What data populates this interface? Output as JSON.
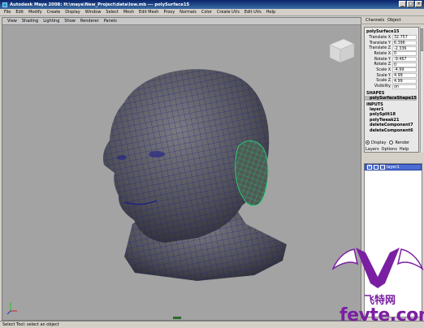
{
  "window": {
    "title": "Autodesk Maya 2008: H:\\maya\\New_Project\\data\\low.mb  ---  polySurface15",
    "minimize": "_",
    "maximize": "□",
    "close": "×"
  },
  "menubar": [
    "File",
    "Edit",
    "Modify",
    "Create",
    "Display",
    "Window",
    "Select",
    "Mesh",
    "Edit Mesh",
    "Proxy",
    "Normals",
    "Color",
    "Create UVs",
    "Edit UVs",
    "Help"
  ],
  "viewport": {
    "menu": [
      "View",
      "Shading",
      "Lighting",
      "Show",
      "Renderer",
      "Panels"
    ],
    "background": "#a3a3a3",
    "mesh_color": "#5a5a62",
    "wire_color": "#1a1a8a",
    "selection_color": "#22e07a"
  },
  "channel_box": {
    "tabs": [
      "Channels",
      "Object"
    ],
    "node": "polySurface15",
    "attributes": [
      {
        "name": "Translate X",
        "value": "32.757"
      },
      {
        "name": "Translate Y",
        "value": "6.396"
      },
      {
        "name": "Translate Z",
        "value": "-2.336"
      },
      {
        "name": "Rotate X",
        "value": "0"
      },
      {
        "name": "Rotate Y",
        "value": "-9.467"
      },
      {
        "name": "Rotate Z",
        "value": "0"
      },
      {
        "name": "Scale X",
        "value": "-4.99"
      },
      {
        "name": "Scale Y",
        "value": "4.99"
      },
      {
        "name": "Scale Z",
        "value": "4.99"
      },
      {
        "name": "Visibility",
        "value": "on"
      }
    ],
    "shapes_label": "SHAPES",
    "shape": "polySurfaceShape15",
    "inputs_label": "INPUTS",
    "inputs": [
      "layer1",
      "polySplit18",
      "polyTweak21",
      "deleteComponent7",
      "deleteComponent6"
    ]
  },
  "layer_editor": {
    "display_label": "Display",
    "render_label": "Render",
    "menu": [
      "Layers",
      "Options",
      "Help"
    ],
    "layers": [
      {
        "visible": "V",
        "name": "layer1"
      }
    ]
  },
  "status": {
    "text": "Select Tool: select an object"
  },
  "watermark": {
    "cn": "飞特网",
    "en": "fevte.com"
  }
}
